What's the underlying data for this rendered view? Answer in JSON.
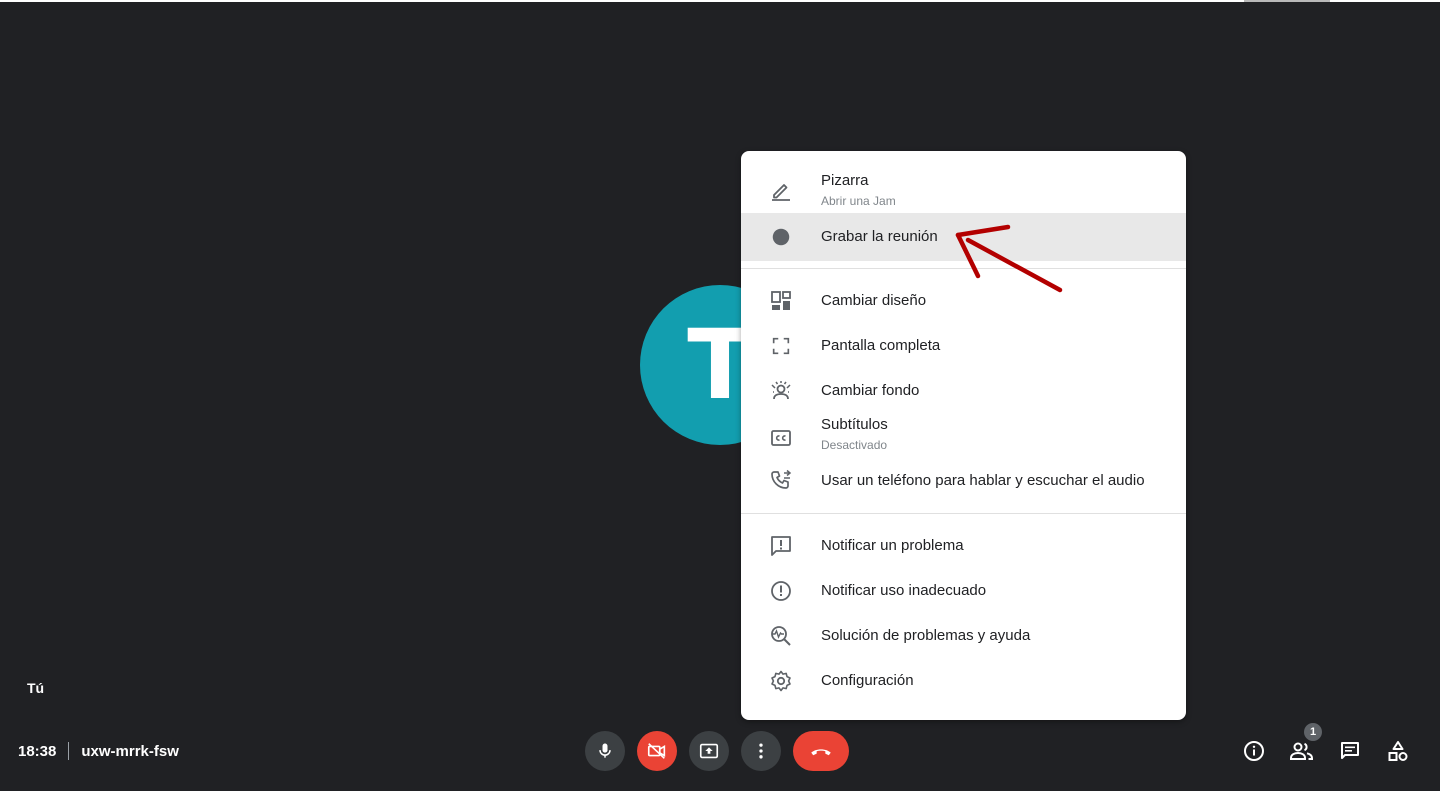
{
  "participant": {
    "initial": "T",
    "self_label": "Tú",
    "avatar_color": "#129eaf"
  },
  "meeting": {
    "time": "18:38",
    "code": "uxw-mrrk-fsw"
  },
  "controls": {
    "mic": "mic-icon",
    "camera_off": "videocam-off-icon",
    "present": "present-screen-icon",
    "more": "more-vert-icon",
    "hangup": "call-end-icon",
    "hangup_color": "#ea4335"
  },
  "right_controls": {
    "info": "info-icon",
    "people": "people-icon",
    "people_count": "1",
    "chat": "chat-icon",
    "activities": "activities-icon"
  },
  "menu": {
    "items": [
      {
        "label": "Pizarra",
        "sub": "Abrir una Jam",
        "icon": "pencil-icon"
      },
      {
        "label": "Grabar la reunión",
        "icon": "record-icon",
        "highlighted": true
      },
      {
        "label": "Cambiar diseño",
        "icon": "layout-icon"
      },
      {
        "label": "Pantalla completa",
        "icon": "fullscreen-icon"
      },
      {
        "label": "Cambiar fondo",
        "icon": "background-icon"
      },
      {
        "label": "Subtítulos",
        "sub": "Desactivado",
        "icon": "captions-icon"
      },
      {
        "label": "Usar un teléfono para hablar y escuchar el audio",
        "icon": "phone-icon"
      },
      {
        "label": "Notificar un problema",
        "icon": "feedback-icon"
      },
      {
        "label": "Notificar uso inadecuado",
        "icon": "report-icon"
      },
      {
        "label": "Solución de problemas y ayuda",
        "icon": "troubleshoot-icon"
      },
      {
        "label": "Configuración",
        "icon": "settings-icon"
      }
    ]
  },
  "annotation": {
    "arrow_color": "#b30000"
  }
}
